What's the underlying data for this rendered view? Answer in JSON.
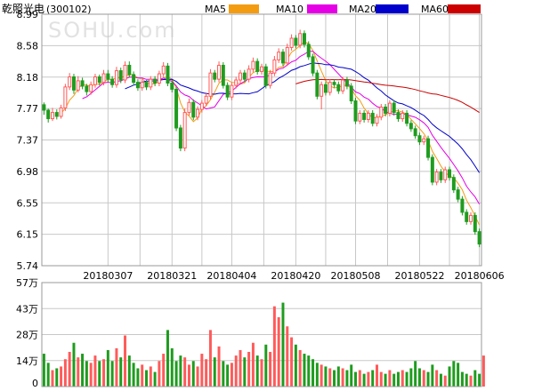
{
  "header": {
    "stock_name": "乾照光电",
    "stock_code": "(300102)",
    "watermark": "SOHU.com"
  },
  "legend": [
    {
      "label": "MA5",
      "color": "#f39c12"
    },
    {
      "label": "MA10",
      "color": "#e600e6"
    },
    {
      "label": "MA20",
      "color": "#0000cc"
    },
    {
      "label": "MA60",
      "color": "#cc0000"
    }
  ],
  "colors": {
    "up": "#ff5a5a",
    "down": "#1e9c1e",
    "grid": "#c8c8c8",
    "frame": "#999999"
  },
  "chart_data": [
    {
      "type": "candlestick",
      "title": "",
      "y_ticks": [
        "8.99",
        "8.58",
        "8.18",
        "7.77",
        "7.37",
        "6.98",
        "6.55",
        "6.15",
        "5.74"
      ],
      "ylim": [
        5.74,
        8.99
      ],
      "x_ticks": [
        {
          "label": "20180307",
          "index": 15
        },
        {
          "label": "20180321",
          "index": 30
        },
        {
          "label": "20180404",
          "index": 44
        },
        {
          "label": "20180420",
          "index": 59
        },
        {
          "label": "20180508",
          "index": 73
        },
        {
          "label": "20180522",
          "index": 88
        },
        {
          "label": "20180606",
          "index": 102
        }
      ],
      "ohlc": [
        [
          7.82,
          7.75,
          7.85,
          7.69
        ],
        [
          7.75,
          7.64,
          7.77,
          7.59
        ],
        [
          7.64,
          7.72,
          7.78,
          7.61
        ],
        [
          7.72,
          7.67,
          7.76,
          7.63
        ],
        [
          7.67,
          7.78,
          7.82,
          7.64
        ],
        [
          7.78,
          8.05,
          8.09,
          7.74
        ],
        [
          8.05,
          8.18,
          8.23,
          8.01
        ],
        [
          8.18,
          8.01,
          8.22,
          7.96
        ],
        [
          8.01,
          8.13,
          8.19,
          7.98
        ],
        [
          8.13,
          8.06,
          8.17,
          8.02
        ],
        [
          8.06,
          7.99,
          8.09,
          7.94
        ],
        [
          7.99,
          8.08,
          8.12,
          7.95
        ],
        [
          8.08,
          8.18,
          8.22,
          8.04
        ],
        [
          8.18,
          8.11,
          8.21,
          8.07
        ],
        [
          8.11,
          8.22,
          8.27,
          8.07
        ],
        [
          8.22,
          8.15,
          8.27,
          8.11
        ],
        [
          8.15,
          8.08,
          8.19,
          8.04
        ],
        [
          8.08,
          8.26,
          8.31,
          8.04
        ],
        [
          8.26,
          8.14,
          8.3,
          8.1
        ],
        [
          8.14,
          8.33,
          8.38,
          8.1
        ],
        [
          8.33,
          8.21,
          8.38,
          8.17
        ],
        [
          8.21,
          8.11,
          8.25,
          8.07
        ],
        [
          8.11,
          8.04,
          8.15,
          8.0
        ],
        [
          8.04,
          8.11,
          8.15,
          8.0
        ],
        [
          8.11,
          8.05,
          8.14,
          8.01
        ],
        [
          8.05,
          8.15,
          8.19,
          8.01
        ],
        [
          8.15,
          8.1,
          8.19,
          8.06
        ],
        [
          8.1,
          8.22,
          8.26,
          8.06
        ],
        [
          8.22,
          8.32,
          8.37,
          8.18
        ],
        [
          8.32,
          8.1,
          8.36,
          8.06
        ],
        [
          8.1,
          8.02,
          8.14,
          7.98
        ],
        [
          8.02,
          7.52,
          8.05,
          7.48
        ],
        [
          7.52,
          7.26,
          7.56,
          7.22
        ],
        [
          7.26,
          7.72,
          7.77,
          7.22
        ],
        [
          7.72,
          7.85,
          7.9,
          7.68
        ],
        [
          7.85,
          7.66,
          7.89,
          7.62
        ],
        [
          7.66,
          7.76,
          7.8,
          7.62
        ],
        [
          7.76,
          7.84,
          7.88,
          7.72
        ],
        [
          7.84,
          7.93,
          7.98,
          7.8
        ],
        [
          7.93,
          8.23,
          8.28,
          7.89
        ],
        [
          8.23,
          8.15,
          8.27,
          8.11
        ],
        [
          8.15,
          8.33,
          8.38,
          8.11
        ],
        [
          8.33,
          8.07,
          8.37,
          8.03
        ],
        [
          8.07,
          7.92,
          8.11,
          7.88
        ],
        [
          7.92,
          8.07,
          8.11,
          7.88
        ],
        [
          8.07,
          8.14,
          8.18,
          8.03
        ],
        [
          8.14,
          8.23,
          8.27,
          8.1
        ],
        [
          8.23,
          8.15,
          8.27,
          8.11
        ],
        [
          8.15,
          8.28,
          8.33,
          8.11
        ],
        [
          8.28,
          8.38,
          8.43,
          8.24
        ],
        [
          8.38,
          8.25,
          8.42,
          8.21
        ],
        [
          8.25,
          8.31,
          8.35,
          8.21
        ],
        [
          8.31,
          8.07,
          8.35,
          8.03
        ],
        [
          8.07,
          8.23,
          8.27,
          8.03
        ],
        [
          8.23,
          8.4,
          8.45,
          8.19
        ],
        [
          8.4,
          8.5,
          8.55,
          8.36
        ],
        [
          8.5,
          8.36,
          8.54,
          8.32
        ],
        [
          8.36,
          8.56,
          8.61,
          8.32
        ],
        [
          8.56,
          8.68,
          8.73,
          8.52
        ],
        [
          8.68,
          8.59,
          8.72,
          8.55
        ],
        [
          8.59,
          8.74,
          8.79,
          8.55
        ],
        [
          8.74,
          8.6,
          8.78,
          8.56
        ],
        [
          8.6,
          8.44,
          8.64,
          8.4
        ],
        [
          8.44,
          8.23,
          8.48,
          8.19
        ],
        [
          8.23,
          7.93,
          8.27,
          7.89
        ],
        [
          7.93,
          8.08,
          8.12,
          7.76
        ],
        [
          8.08,
          7.98,
          8.12,
          7.94
        ],
        [
          7.98,
          8.11,
          8.15,
          7.94
        ],
        [
          8.11,
          8.08,
          8.15,
          8.04
        ],
        [
          8.08,
          8.0,
          8.12,
          7.96
        ],
        [
          8.0,
          8.14,
          8.18,
          7.96
        ],
        [
          8.14,
          8.06,
          8.18,
          8.02
        ],
        [
          8.06,
          7.87,
          8.1,
          7.83
        ],
        [
          7.87,
          7.61,
          7.91,
          7.57
        ],
        [
          7.61,
          7.71,
          7.75,
          7.57
        ],
        [
          7.71,
          7.63,
          7.75,
          7.59
        ],
        [
          7.63,
          7.71,
          7.75,
          7.59
        ],
        [
          7.71,
          7.58,
          7.75,
          7.54
        ],
        [
          7.58,
          7.66,
          7.7,
          7.54
        ],
        [
          7.66,
          7.79,
          7.83,
          7.62
        ],
        [
          7.79,
          7.71,
          7.83,
          7.67
        ],
        [
          7.71,
          7.84,
          7.88,
          7.67
        ],
        [
          7.84,
          7.72,
          7.88,
          7.68
        ],
        [
          7.72,
          7.64,
          7.76,
          7.6
        ],
        [
          7.64,
          7.71,
          7.75,
          7.6
        ],
        [
          7.71,
          7.58,
          7.75,
          7.54
        ],
        [
          7.58,
          7.51,
          7.62,
          7.47
        ],
        [
          7.51,
          7.42,
          7.55,
          7.38
        ],
        [
          7.42,
          7.34,
          7.46,
          7.3
        ],
        [
          7.34,
          7.38,
          7.42,
          7.3
        ],
        [
          7.38,
          7.14,
          7.42,
          7.1
        ],
        [
          7.14,
          6.82,
          7.18,
          6.78
        ],
        [
          6.82,
          6.95,
          6.99,
          6.78
        ],
        [
          6.95,
          6.85,
          6.99,
          6.81
        ],
        [
          6.85,
          6.98,
          7.02,
          6.81
        ],
        [
          6.98,
          6.88,
          7.02,
          6.84
        ],
        [
          6.88,
          6.72,
          6.92,
          6.68
        ],
        [
          6.72,
          6.6,
          6.76,
          6.56
        ],
        [
          6.6,
          6.43,
          6.64,
          6.39
        ],
        [
          6.43,
          6.31,
          6.47,
          6.27
        ],
        [
          6.31,
          6.39,
          6.43,
          6.27
        ],
        [
          6.39,
          6.18,
          6.43,
          6.14
        ],
        [
          6.18,
          6.02,
          6.22,
          5.98
        ]
      ]
    },
    {
      "type": "bar",
      "title": "",
      "y_ticks": [
        "57万",
        "43万",
        "28万",
        "14万",
        "0"
      ],
      "ylim": [
        0,
        57
      ],
      "unit": "万",
      "volumes": [
        18,
        13,
        9,
        10,
        11,
        15,
        19,
        24,
        16,
        18,
        14,
        13,
        17,
        14,
        15,
        20,
        14,
        21,
        16,
        28,
        17,
        13,
        10,
        12,
        9,
        11,
        8,
        14,
        18,
        31,
        21,
        14,
        17,
        16,
        12,
        14,
        11,
        18,
        15,
        31,
        16,
        22,
        14,
        12,
        13,
        17,
        20,
        16,
        19,
        24,
        17,
        15,
        23,
        19,
        44,
        38,
        46,
        33,
        27,
        23,
        20,
        18,
        17,
        15,
        13,
        12,
        11,
        10,
        9,
        11,
        10,
        9,
        12,
        8,
        9,
        7,
        8,
        9,
        12,
        8,
        7,
        9,
        7,
        8,
        9,
        8,
        10,
        14,
        10,
        9,
        8,
        12,
        9,
        7,
        6,
        11,
        14,
        13,
        8,
        7,
        6,
        9,
        7,
        17
      ]
    }
  ]
}
